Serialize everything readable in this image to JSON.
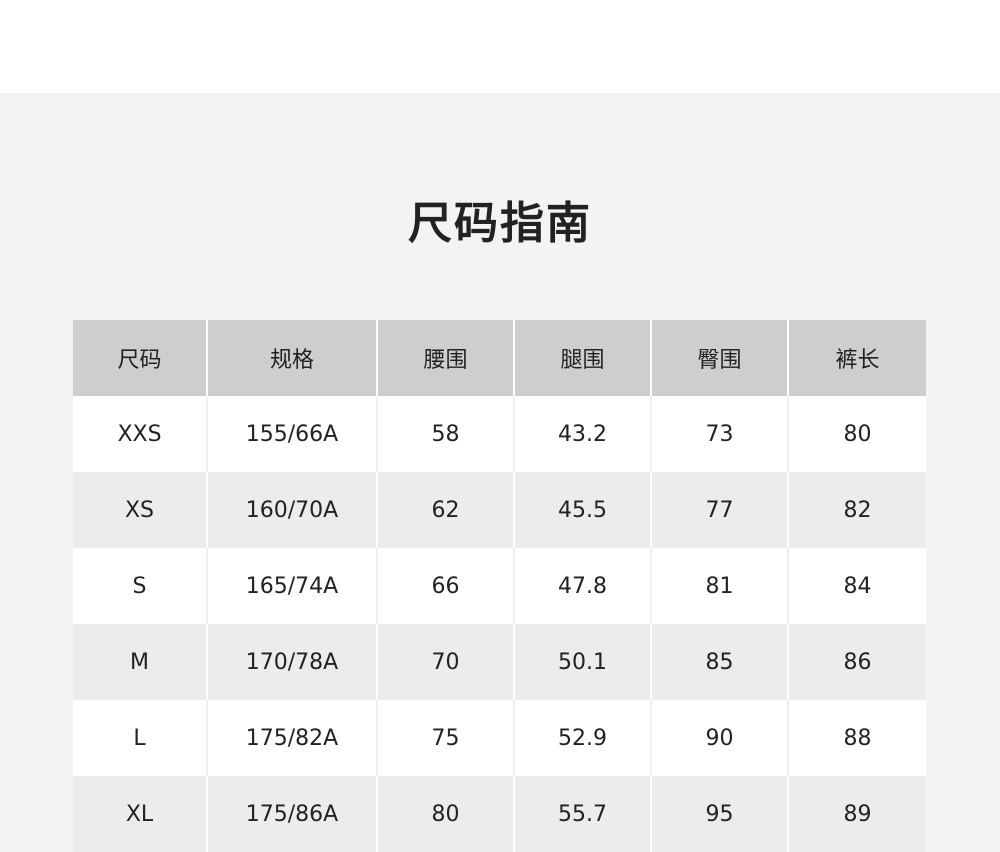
{
  "title": "尺码指南",
  "table": {
    "headers": [
      "尺码",
      "规格",
      "腰围",
      "腿围",
      "臀围",
      "裤长"
    ],
    "rows": [
      [
        "XXS",
        "155/66A",
        "58",
        "43.2",
        "73",
        "80"
      ],
      [
        "XS",
        "160/70A",
        "62",
        "45.5",
        "77",
        "82"
      ],
      [
        "S",
        "165/74A",
        "66",
        "47.8",
        "81",
        "84"
      ],
      [
        "M",
        "170/78A",
        "70",
        "50.1",
        "85",
        "86"
      ],
      [
        "L",
        "175/82A",
        "75",
        "52.9",
        "90",
        "88"
      ],
      [
        "XL",
        "175/86A",
        "80",
        "55.7",
        "95",
        "89"
      ]
    ]
  }
}
